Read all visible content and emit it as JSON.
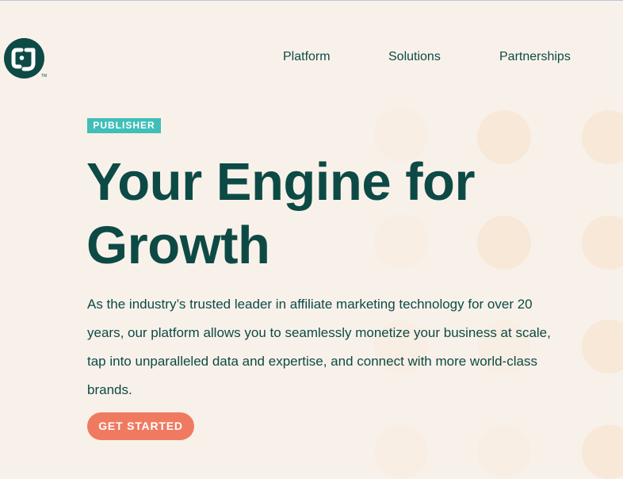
{
  "brand": {
    "logo_text": "CJ",
    "trademark": "TM"
  },
  "nav": {
    "items": [
      {
        "label": "Platform"
      },
      {
        "label": "Solutions"
      },
      {
        "label": "Partnerships"
      }
    ]
  },
  "hero": {
    "badge": "PUBLISHER",
    "headline_line1": "Your Engine for",
    "headline_line2": "Growth",
    "description": "As the industry’s trusted leader in affiliate marketing technology for over 20 years, our platform allows you to seamlessly monetize your business at scale, tap into unparalleled data and expertise, and connect with more world-class brands.",
    "cta_label": "GET STARTED"
  },
  "colors": {
    "background": "#f8f1ea",
    "brand_green": "#0d4a45",
    "badge_teal": "#3fbfb8",
    "cta_coral": "#f07a60",
    "decorative_dot": "#f7e8d8"
  }
}
